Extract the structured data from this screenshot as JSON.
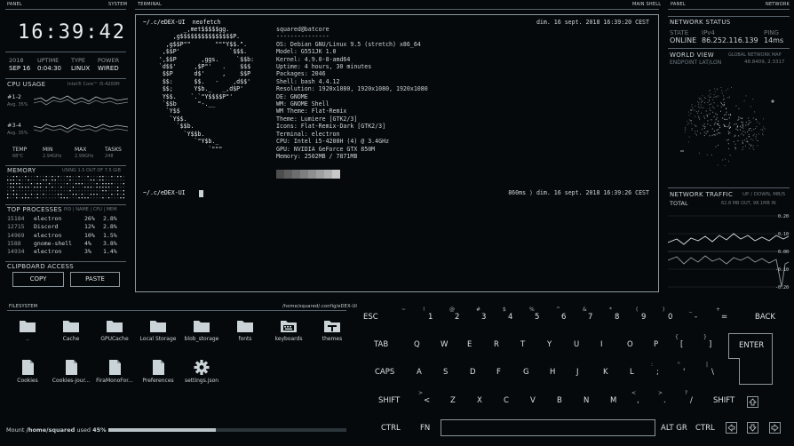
{
  "headers": {
    "panel_left": "PANEL",
    "system": "SYSTEM",
    "terminal": "TERMINAL",
    "main_shell": "MAIN SHELL",
    "panel_right": "PANEL",
    "network": "NETWORK",
    "filesystem": "FILESYSTEM",
    "fs_path": "/home/squared/.config/eDEX-UI"
  },
  "clock": {
    "time": "16:39:42"
  },
  "sysinfo": [
    {
      "h": "2018",
      "v": "SEP 16"
    },
    {
      "h": "UPTIME",
      "v": "0:04:30"
    },
    {
      "h": "TYPE",
      "v": "LINUX"
    },
    {
      "h": "POWER",
      "v": "WIRED"
    }
  ],
  "cpu": {
    "title": "CPU USAGE",
    "model": "Intel® Core™ i5-4200H",
    "rows": [
      {
        "label": "#1-2",
        "avg": "Avg. 35%"
      },
      {
        "label": "#3-4",
        "avg": "Avg. 35%"
      }
    ]
  },
  "cpu_stats": [
    {
      "h": "TEMP",
      "v": "68°C"
    },
    {
      "h": "MIN",
      "v": "2.94GHz"
    },
    {
      "h": "MAX",
      "v": "2.99GHz"
    },
    {
      "h": "TASKS",
      "v": "248"
    }
  ],
  "memory": {
    "title": "MEMORY",
    "usage": "USING 1.5 OUT OF 7.5 GiB"
  },
  "processes": {
    "title": "TOP PROCESSES",
    "cols": "PID | NAME | CPU | MEM",
    "rows": [
      {
        "pid": "15184",
        "name": "electron",
        "cpu": "26%",
        "mem": "2.8%"
      },
      {
        "pid": "12715",
        "name": "Discord",
        "cpu": "12%",
        "mem": "2.8%"
      },
      {
        "pid": "14969",
        "name": "electron",
        "cpu": "10%",
        "mem": "1.5%"
      },
      {
        "pid": "1588",
        "name": "gnome-shell",
        "cpu": "4%",
        "mem": "3.8%"
      },
      {
        "pid": "14934",
        "name": "electron",
        "cpu": "3%",
        "mem": "1.4%"
      }
    ]
  },
  "clipboard": {
    "title": "CLIPBOARD ACCESS",
    "copy": "COPY",
    "paste": "PASTE"
  },
  "terminal": {
    "prompt": "~/.c/eDEX-UI",
    "cmd1": "neofetch",
    "ts1": "dim. 16 sept. 2018 16:39:20 CEST",
    "ts2": "860ms ⟩ dim. 16 sept. 2018 16:39:26 CEST",
    "logo": "            _,met$$$$$gg.\n         ,g$$$$$$$$$$$$$$$P.\n       ,g$$P\"\"       \"\"\"Y$$.\".\n      ,$$P'              `$$$.\n     ',$$P       ,ggs.     `$$b:\n     `d$$'     ,$P\"'   .    $$$\n      $$P      d$'     ,    $$P\n      $$:      $$.   -    ,d$$'\n      $$;      Y$b._   _,d$P'\n      Y$$.    `.`\"Y$$$$P\"'\n      `$$b      \"-.__\n       `Y$$\n        `Y$$.\n          `$$b.\n            `Y$$b.\n               `\"Y$b._\n                   `\"\"\"",
    "info": [
      "squared@batcore",
      "---------------",
      "OS: Debian GNU/Linux 9.5 (stretch) x86_64",
      "Model: G551JK 1.0",
      "Kernel: 4.9.0-8-amd64",
      "Uptime: 4 hours, 30 minutes",
      "Packages: 2046",
      "Shell: bash 4.4.12",
      "Resolution: 1920x1080, 1920x1080, 1920x1080",
      "DE: GNOME",
      "WM: GNOME Shell",
      "WM Theme: Flat-Remix",
      "Theme: Lumiere [GTK2/3]",
      "Icons: Flat-Remix-Dark [GTK2/3]",
      "Terminal: electron",
      "CPU: Intel i5-4200H (4) @ 3.4GHz",
      "GPU: NVIDIA GeForce GTX 850M",
      "Memory: 2502MB / 7871MB"
    ],
    "palette": [
      "#4d4d4d",
      "#5e5e5e",
      "#6e6e6e",
      "#7f7f7f",
      "#8f8f8f",
      "#a0a0a0",
      "#b1b1b1",
      "#c9c9c9"
    ]
  },
  "netstatus": {
    "title": "NETWORK STATUS",
    "state_h": "STATE",
    "state_v": "ONLINE",
    "ip_h": "IPv4",
    "ip_v": "86.252.116.139",
    "ping_h": "PING",
    "ping_v": "14ms"
  },
  "worldview": {
    "title": "WORLD VIEW",
    "sub": "GLOBAL NETWORK MAP",
    "endpoint": "ENDPOINT LAT/LON",
    "coords": "48.8409, 2.3317"
  },
  "traffic": {
    "title": "NETWORK TRAFFIC",
    "sub": "UP / DOWN, MB/S",
    "total": "TOTAL",
    "total_v": "62.8 MB OUT, 98.1MB IN",
    "scale": [
      "0.20",
      "0.10",
      "0.00",
      "-0.10",
      "-0.20"
    ]
  },
  "files": [
    {
      "name": "..",
      "icon": "folder-icon"
    },
    {
      "name": "Cache",
      "icon": "folder-icon"
    },
    {
      "name": "GPUCache",
      "icon": "folder-icon"
    },
    {
      "name": "Local Storage",
      "icon": "folder-icon"
    },
    {
      "name": "blob_storage",
      "icon": "folder-icon"
    },
    {
      "name": "fonts",
      "icon": "folder-icon"
    },
    {
      "name": "keyboards",
      "icon": "keyboard-icon"
    },
    {
      "name": "themes",
      "icon": "palette-icon"
    },
    {
      "name": "Cookies",
      "icon": "file-icon"
    },
    {
      "name": "Cookies-jour...",
      "icon": "file-icon"
    },
    {
      "name": "FiraMonoFor...",
      "icon": "file-icon"
    },
    {
      "name": "Preferences",
      "icon": "file-icon"
    },
    {
      "name": "settings.json",
      "icon": "gear-icon"
    }
  ],
  "mount": {
    "prefix": "Mount",
    "path": "/home/squared",
    "used": "used",
    "pct": "45%",
    "fill": 0.45
  },
  "keyboard": {
    "row1": [
      {
        "m": "ESC"
      },
      {
        "m": "1",
        "s": "!",
        "t": "~"
      },
      {
        "m": "2",
        "s": "@"
      },
      {
        "m": "3",
        "s": "#"
      },
      {
        "m": "4",
        "s": "$"
      },
      {
        "m": "5",
        "s": "%"
      },
      {
        "m": "6",
        "s": "^"
      },
      {
        "m": "7",
        "s": "&"
      },
      {
        "m": "8",
        "s": "*"
      },
      {
        "m": "9",
        "s": "("
      },
      {
        "m": "0",
        "s": ")"
      },
      {
        "m": "-",
        "s": "_"
      },
      {
        "m": "=",
        "s": "+"
      },
      {
        "m": "BACK"
      }
    ],
    "row2": [
      {
        "m": "TAB"
      },
      {
        "m": "Q"
      },
      {
        "m": "W"
      },
      {
        "m": "E"
      },
      {
        "m": "R"
      },
      {
        "m": "T"
      },
      {
        "m": "Y"
      },
      {
        "m": "U"
      },
      {
        "m": "I"
      },
      {
        "m": "O"
      },
      {
        "m": "P"
      },
      {
        "m": "[",
        "s": "{"
      },
      {
        "m": "]",
        "s": "}"
      }
    ],
    "row3": [
      {
        "m": "CAPS"
      },
      {
        "m": "A"
      },
      {
        "m": "S"
      },
      {
        "m": "D"
      },
      {
        "m": "F"
      },
      {
        "m": "G"
      },
      {
        "m": "H"
      },
      {
        "m": "J"
      },
      {
        "m": "K"
      },
      {
        "m": "L"
      },
      {
        "m": ";",
        "s": ":"
      },
      {
        "m": "'",
        "s": "\""
      },
      {
        "m": "\\",
        "s": "|"
      }
    ],
    "row4": [
      {
        "m": "SHIFT"
      },
      {
        "m": "<",
        "s": ">"
      },
      {
        "m": "Z"
      },
      {
        "m": "X"
      },
      {
        "m": "C"
      },
      {
        "m": "V"
      },
      {
        "m": "B"
      },
      {
        "m": "N"
      },
      {
        "m": "M"
      },
      {
        "m": ",",
        "s": "<"
      },
      {
        "m": ".",
        "s": ">"
      },
      {
        "m": "/",
        "s": "?"
      },
      {
        "m": "SHIFT"
      }
    ],
    "row5": [
      {
        "m": "CTRL"
      },
      {
        "m": "FN"
      },
      {
        "m": "ALT GR"
      },
      {
        "m": "CTRL"
      }
    ],
    "enter": "ENTER"
  }
}
